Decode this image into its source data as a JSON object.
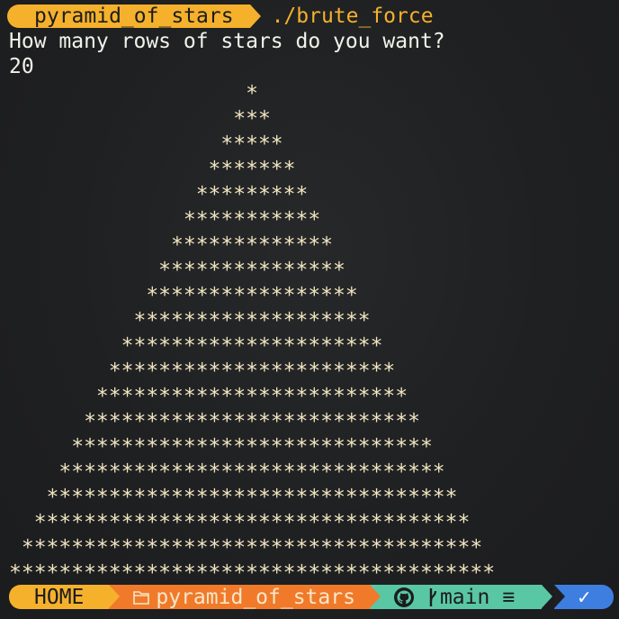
{
  "prompt": {
    "directory": "pyramid_of_stars",
    "command": "./brute_force"
  },
  "output": {
    "question": "How many rows of stars do you want?",
    "answer": "20",
    "rows": 20
  },
  "statusbar": {
    "home": "HOME",
    "directory": "pyramid_of_stars",
    "branch": "main",
    "branch_status": "≡",
    "ok_mark": "✓"
  },
  "colors": {
    "yellow": "#f5b12c",
    "orange": "#f07a2a",
    "teal": "#5ac7a4",
    "blue": "#3d7ee0",
    "background": "#1e1f21"
  }
}
